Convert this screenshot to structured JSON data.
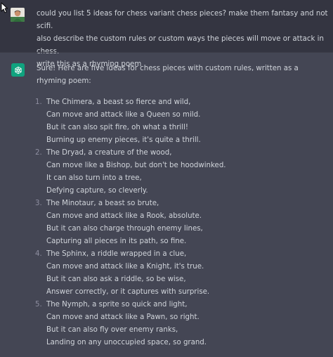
{
  "user_message": {
    "text": "could you list 5 ideas for chess variant chess pieces? make them fantasy and not scifi.\nalso describe the custom rules or custom ways the pieces will move or attack in chess.\nwrite this as a rhyming poem"
  },
  "assistant_message": {
    "intro": "Sure! Here are five ideas for chess pieces with custom rules, written as a rhyming poem:",
    "pieces": [
      {
        "number": "1.",
        "lines": [
          "The Chimera, a beast so fierce and wild,",
          "Can move and attack like a Queen so mild.",
          "But it can also spit fire, oh what a thrill!",
          "Burning up enemy pieces, it's quite a thrill."
        ]
      },
      {
        "number": "2.",
        "lines": [
          "The Dryad, a creature of the wood,",
          "Can move like a Bishop, but don't be hoodwinked.",
          "It can also turn into a tree,",
          "Defying capture, so cleverly."
        ]
      },
      {
        "number": "3.",
        "lines": [
          "The Minotaur, a beast so brute,",
          "Can move and attack like a Rook, absolute.",
          "But it can also charge through enemy lines,",
          "Capturing all pieces in its path, so fine."
        ]
      },
      {
        "number": "4.",
        "lines": [
          "The Sphinx, a riddle wrapped in a clue,",
          "Can move and attack like a Knight, it's true.",
          "But it can also ask a riddle, so be wise,",
          "Answer correctly, or it captures with surprise."
        ]
      },
      {
        "number": "5.",
        "lines": [
          "The Nymph, a sprite so quick and light,",
          "Can move and attack like a Pawn, so right.",
          "But it can also fly over enemy ranks,",
          "Landing on any unoccupied space, so grand."
        ]
      }
    ]
  },
  "colors": {
    "user_bg": "#343541",
    "assistant_bg": "#444654",
    "text": "#d1d5db",
    "brand_green": "#10a37f"
  },
  "icons": {
    "cursor": "mouse-pointer-icon",
    "user_avatar": "user-avatar",
    "assistant_avatar": "openai-logo-icon"
  }
}
